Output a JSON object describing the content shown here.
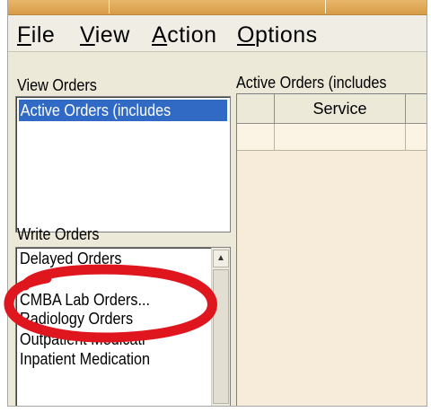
{
  "menu": [
    {
      "first": "F",
      "rest": "ile"
    },
    {
      "first": "V",
      "rest": "iew"
    },
    {
      "first": "A",
      "rest": "ction"
    },
    {
      "first": "O",
      "rest": "ptions"
    }
  ],
  "view_orders": {
    "label": "View Orders",
    "selected": "Active Orders (includes"
  },
  "write_orders": {
    "label": "Write Orders",
    "items": [
      "Delayed Orders",
      "",
      "CMBA Lab Orders...",
      "Radiology Orders",
      "Outpatient Medicati",
      "Inpatient Medication"
    ]
  },
  "orders_grid": {
    "title": "Active Orders (includes",
    "columns": [
      "",
      "Service",
      ""
    ]
  },
  "colors": {
    "selection": "#316ac5",
    "annotation": "#e0161e",
    "titlebar": "#d79b46"
  },
  "icons": {
    "scroll_up": "▲"
  }
}
